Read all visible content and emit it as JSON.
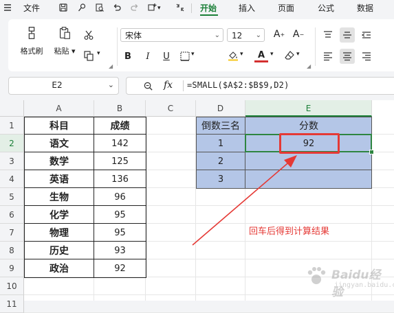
{
  "menubar": {
    "file_label": "文件",
    "tabs": [
      {
        "label": "开始",
        "active": true
      },
      {
        "label": "插入",
        "active": false
      },
      {
        "label": "页面",
        "active": false
      },
      {
        "label": "公式",
        "active": false
      },
      {
        "label": "数据",
        "active": false
      }
    ],
    "accent_color": "#1a7f37"
  },
  "ribbon": {
    "format_painter_label": "格式刷",
    "paste_label": "粘贴",
    "font_name": "宋体",
    "font_size": "12",
    "bold_label": "B",
    "italic_label": "I",
    "underline_label": "U",
    "font_color_label": "A",
    "grow_font_label": "A+",
    "shrink_font_label": "A-",
    "icons": [
      "hamburger-icon",
      "save-icon",
      "format-icon",
      "print-preview-icon",
      "undo-icon",
      "redo-icon",
      "add-icon",
      "expand-icon",
      "paste-icon",
      "cut-icon",
      "copy-icon",
      "border-icon",
      "fill-color-icon",
      "eraser-icon",
      "align-top-icon",
      "align-middle-icon",
      "indent-icon",
      "align-left-icon",
      "align-center-icon",
      "align-right-icon"
    ]
  },
  "formula_bar": {
    "name_box": "E2",
    "zoom_icon": "zoom-icon",
    "fx_label": "fx",
    "formula": "=SMALL($A$2:$B$9,D2)"
  },
  "sheet": {
    "columns": [
      "A",
      "B",
      "C",
      "D",
      "E"
    ],
    "rows": [
      "1",
      "2",
      "3",
      "4",
      "5",
      "6",
      "7",
      "8",
      "9",
      "10",
      "11"
    ],
    "selected_cell": "E2",
    "table1": {
      "headers": [
        "科目",
        "成绩"
      ],
      "rows": [
        [
          "语文",
          "142"
        ],
        [
          "数学",
          "125"
        ],
        [
          "英语",
          "136"
        ],
        [
          "生物",
          "96"
        ],
        [
          "化学",
          "95"
        ],
        [
          "物理",
          "95"
        ],
        [
          "历史",
          "93"
        ],
        [
          "政治",
          "92"
        ]
      ]
    },
    "table2": {
      "headers": [
        "倒数三名",
        "分数"
      ],
      "rows": [
        [
          "1",
          "92"
        ],
        [
          "2",
          ""
        ],
        [
          "3",
          ""
        ]
      ],
      "fill_color": "#b4c6e7"
    }
  },
  "annotation": {
    "text": "回车后得到计算结果",
    "color": "#e53935"
  },
  "watermark": {
    "line1": "Baidu经验",
    "line2": "jingyan.baidu.com"
  }
}
